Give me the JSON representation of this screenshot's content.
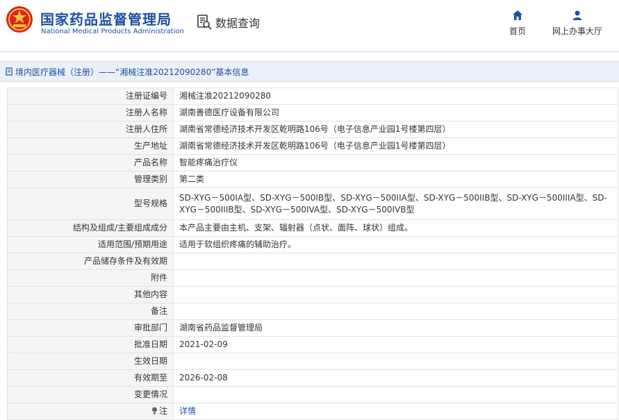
{
  "header": {
    "site_name_cn": "国家药品监督管理局",
    "site_name_en": "National Medical Products Administration",
    "query_label": "数据查询",
    "nav": [
      {
        "label": "首页",
        "icon": "home-icon"
      },
      {
        "label": "网上办事大厅",
        "icon": "user-icon"
      }
    ]
  },
  "breadcrumb": {
    "text": "境内医疗器械（注册）——“湘械注准20212090280”基本信息",
    "icon": "doc-icon"
  },
  "rows": [
    {
      "key": "注册证编号",
      "value": "湘械注准20212090280"
    },
    {
      "key": "注册人名称",
      "value": "湖南善德医疗设备有限公司"
    },
    {
      "key": "注册人住所",
      "value": "湖南省常德经济技术开发区乾明路106号（电子信息产业园1号楼第四层）"
    },
    {
      "key": "生产地址",
      "value": "湖南省常德经济技术开发区乾明路106号（电子信息产业园1号楼第四层）"
    },
    {
      "key": "产品名称",
      "value": "智能疼痛治疗仪"
    },
    {
      "key": "管理类别",
      "value": "第二类"
    },
    {
      "key": "型号规格",
      "value": "SD-XYG－500IA型、SD-XYG－500IB型、SD-XYG－500IIA型、SD-XYG－500IIB型、SD-XYG－500IIIA型、SD-XYG－500IIIB型、SD-XYG－500IVA型、SD-XYG－500IVB型"
    },
    {
      "key": "结构及组成/主要组成成分",
      "value": "本产品主要由主机、支架、辐射器（点状、面阵、球状）组成。"
    },
    {
      "key": "适用范围/预期用途",
      "value": "适用于软组织疼痛的辅助治疗。"
    },
    {
      "key": "产品储存条件及有效期",
      "value": ""
    },
    {
      "key": "附件",
      "value": ""
    },
    {
      "key": "其他内容",
      "value": ""
    },
    {
      "key": "备注",
      "value": ""
    },
    {
      "key": "审批部门",
      "value": "湖南省药品监督管理局"
    },
    {
      "key": "批准日期",
      "value": "2021-02-09"
    },
    {
      "key": "生效日期",
      "value": ""
    },
    {
      "key": "有效期至",
      "value": "2026-02-08"
    },
    {
      "key": "变更情况",
      "value": ""
    },
    {
      "key": "注",
      "value": "详情"
    }
  ],
  "colors": {
    "brand": "#1e4fa0",
    "emblem_red": "#d7261e",
    "emblem_gold": "#f2c33a",
    "key_bg": "#f5f5f5"
  }
}
